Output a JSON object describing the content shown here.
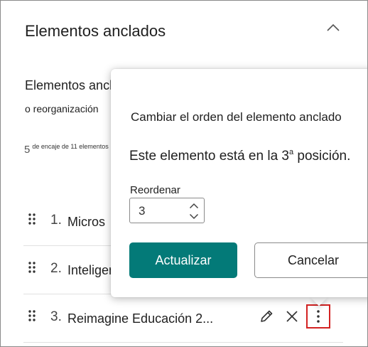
{
  "panel": {
    "title": "Elementos anclados",
    "collapse_icon": "chevron-up-icon"
  },
  "section": {
    "title": "Elementos anclados",
    "subtitle": "o reorganización",
    "count_number": "5",
    "count_text": "de encaje de 11 elementos"
  },
  "rows": [
    {
      "number": "1.",
      "label": "Micros"
    },
    {
      "number": "2.",
      "label": "Inteligente"
    },
    {
      "number": "3.",
      "label": "Reimagine Educación 2..."
    }
  ],
  "row_actions": {
    "edit_icon": "pencil-icon",
    "remove_icon": "close-icon",
    "more_icon": "more-vertical-icon"
  },
  "popup": {
    "title": "Cambiar el orden del elemento anclado",
    "status_prefix": "Este elemento está en la 3",
    "status_sup": "a",
    "status_suffix": " posición.",
    "reorder_label": "Reordenar",
    "reorder_value": "3",
    "update_label": "Actualizar",
    "cancel_label": "Cancelar"
  },
  "colors": {
    "primary": "#037a78",
    "highlight": "#d32222"
  }
}
